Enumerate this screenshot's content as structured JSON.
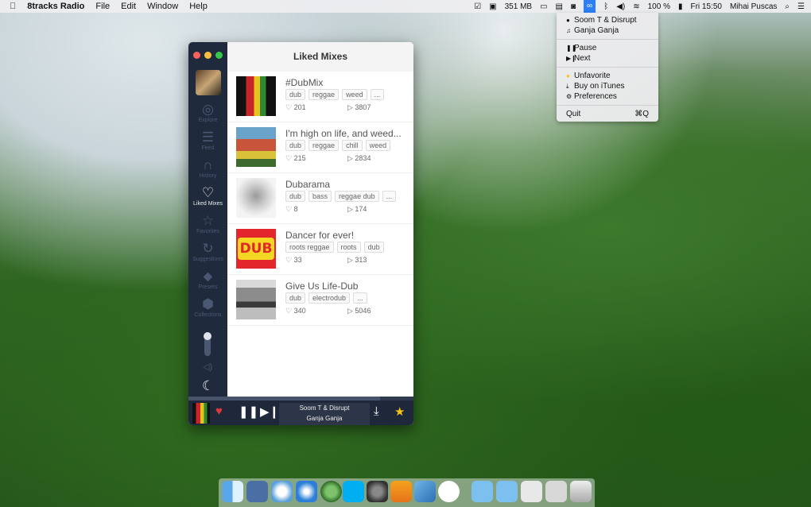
{
  "menubar": {
    "app_name": "8tracks Radio",
    "menus": [
      "File",
      "Edit",
      "Window",
      "Help"
    ],
    "memory": "351 MB",
    "battery": "100 %",
    "clock": "Fri 15:50",
    "user": "Mihai Puscas"
  },
  "dropdown": {
    "artist": "Soom T & Disrupt",
    "song": "Ganja Ganja",
    "pause": "Pause",
    "next": "Next",
    "unfavorite": "Unfavorite",
    "buy": "Buy on iTunes",
    "preferences": "Preferences",
    "quit": "Quit",
    "quit_shortcut": "⌘Q"
  },
  "window": {
    "title": "Liked Mixes",
    "nav": {
      "explore": "Explore",
      "feed": "Feed",
      "history": "History",
      "liked": "Liked Mixes",
      "favorites": "Favorites",
      "suggestions": "Suggestions",
      "presets": "Presets",
      "collections": "Collections"
    }
  },
  "mixes": [
    {
      "title": "#DubMix",
      "tags": [
        "dub",
        "reggae",
        "weed",
        "..."
      ],
      "likes": "201",
      "plays": "3807"
    },
    {
      "title": "I'm high on life, and weed...",
      "tags": [
        "dub",
        "reggae",
        "chill",
        "weed"
      ],
      "likes": "215",
      "plays": "2834"
    },
    {
      "title": "Dubarama",
      "tags": [
        "dub",
        "bass",
        "reggae dub",
        "..."
      ],
      "likes": "8",
      "plays": "174"
    },
    {
      "title": "Dancer for ever!",
      "tags": [
        "roots reggae",
        "roots",
        "dub"
      ],
      "likes": "33",
      "plays": "313",
      "cover_text": "DUB"
    },
    {
      "title": "Give Us Life-Dub",
      "tags": [
        "dub",
        "electrodub",
        "..."
      ],
      "likes": "340",
      "plays": "5046"
    }
  ],
  "player": {
    "artist": "Soom T & Disrupt",
    "song": "Ganja Ganja",
    "progress": 0.85
  },
  "colors": {
    "sidebar": "#1f2a3c",
    "heart": "#e0363b",
    "star": "#f5c518",
    "menu_highlight": "#2d7ff5"
  }
}
